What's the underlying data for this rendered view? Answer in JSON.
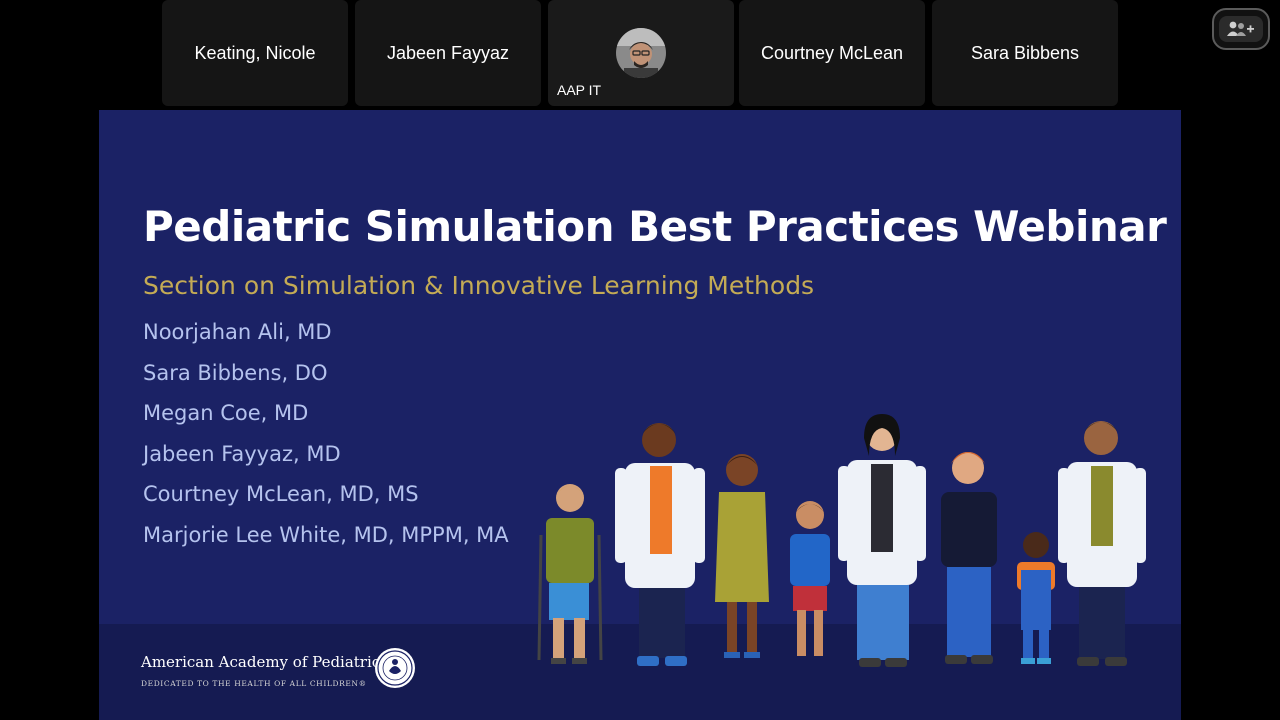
{
  "participants": [
    {
      "name": "Keating, Nicole"
    },
    {
      "name": "Jabeen Fayyaz"
    },
    {
      "name": "AAP IT",
      "avatar": "user-photo"
    },
    {
      "name": "Courtney McLean"
    },
    {
      "name": "Sara Bibbens"
    }
  ],
  "controls": {
    "people_icon": "people-plus-icon"
  },
  "slide": {
    "title": "Pediatric Simulation Best Practices Webinar",
    "subtitle": "Section on Simulation & Innovative Learning Methods",
    "presenters": [
      "Noorjahan Ali, MD",
      "Sara Bibbens, DO",
      "Megan Coe, MD",
      "Jabeen Fayyaz, MD",
      "Courtney McLean, MD, MS",
      "Marjorie Lee White, MD, MPPM, MA"
    ],
    "organization": {
      "name": "American Academy of Pediatrics",
      "tagline": "DEDICATED TO THE HEALTH OF ALL CHILDREN®"
    },
    "colors": {
      "background": "#1b2265",
      "title": "#ffffff",
      "subtitle": "#c4ab55",
      "presenters": "#b5c3ee"
    }
  }
}
